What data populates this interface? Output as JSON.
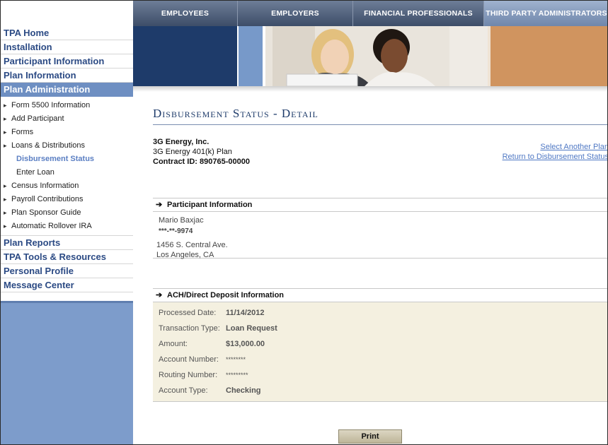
{
  "topnav": {
    "tabs": [
      {
        "label": "Employees",
        "active": false
      },
      {
        "label": "Employers",
        "active": false
      },
      {
        "label": "Financial Professionals",
        "active": false
      },
      {
        "label": "Third Party Administrators",
        "active": true
      }
    ]
  },
  "sidebar": {
    "top_items": [
      "TPA Home",
      "Installation",
      "Participant Information",
      "Plan Information"
    ],
    "active_item": "Plan Administration",
    "sub_items": [
      {
        "label": "Form 5500 Information",
        "arrow": true,
        "child": false,
        "current": false
      },
      {
        "label": "Add Participant",
        "arrow": true,
        "child": false,
        "current": false
      },
      {
        "label": "Forms",
        "arrow": true,
        "child": false,
        "current": false
      },
      {
        "label": "Loans & Distributions",
        "arrow": true,
        "child": false,
        "current": false
      },
      {
        "label": "Disbursement Status",
        "arrow": false,
        "child": true,
        "current": true
      },
      {
        "label": "Enter Loan",
        "arrow": false,
        "child": true,
        "current": false
      },
      {
        "label": "Census Information",
        "arrow": true,
        "child": false,
        "current": false
      },
      {
        "label": "Payroll Contributions",
        "arrow": true,
        "child": false,
        "current": false
      },
      {
        "label": "Plan Sponsor Guide",
        "arrow": true,
        "child": false,
        "current": false
      },
      {
        "label": "Automatic Rollover IRA",
        "arrow": true,
        "child": false,
        "current": false
      }
    ],
    "bottom_items": [
      "Plan Reports",
      "TPA Tools & Resources",
      "Personal Profile",
      "Message Center"
    ]
  },
  "page": {
    "title": "Disbursement Status - Detail",
    "company": "3G Energy, Inc.",
    "plan": "3G Energy 401(k) Plan",
    "contract": "Contract ID: 890765-00000",
    "link_select_plan": "Select Another Plan",
    "link_return": "Return to Disbursement Status"
  },
  "participant": {
    "header": "Participant Information",
    "name": "Mario Baxjac",
    "ssn": "***-**-9974",
    "address1": "1456 S. Central Ave.",
    "address2": "Los Angeles, CA"
  },
  "ach": {
    "header": "ACH/Direct Deposit Information",
    "rows": [
      {
        "label": "Processed Date:",
        "value": "11/14/2012",
        "mask": false
      },
      {
        "label": "Transaction Type:",
        "value": "Loan Request",
        "mask": false
      },
      {
        "label": "Amount:",
        "value": "$13,000.00",
        "mask": false
      },
      {
        "label": "Account Number:",
        "value": "********",
        "mask": true
      },
      {
        "label": "Routing Number:",
        "value": "*********",
        "mask": true
      },
      {
        "label": "Account Type:",
        "value": "Checking",
        "mask": false
      }
    ]
  },
  "print_label": "Print",
  "colors": {
    "navy": "#1e3b6a",
    "sidebar_blue": "#7d9ccb",
    "accent_orange": "#d0945f",
    "ach_bg": "#f4f0e0"
  },
  "icons": {
    "arrow": "right-arrow-icon",
    "bullet": "triangle-bullet-icon"
  }
}
